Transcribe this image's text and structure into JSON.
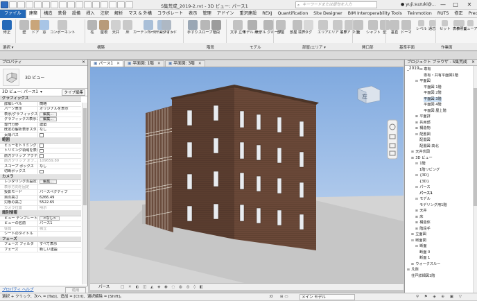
{
  "app": {
    "doc_title": "S集荒成_2019-2.rvt - 3D ビュー: パース1",
    "search_placeholder": "キーワードまたは語句を入力",
    "user": "yuji.suzuki@...",
    "win": {
      "min": "—",
      "max": "□",
      "close": "✕"
    }
  },
  "ribbon_tabs": [
    "ファイル",
    "建築",
    "構造",
    "鉄骨",
    "設備",
    "挿入",
    "注釈",
    "解析",
    "マス & 外構",
    "コラボレート",
    "表示",
    "管理",
    "アドイン",
    "重沢建設",
    "REXJ",
    "Quantification",
    "Site Designer",
    "BIM Interoperability Tools",
    "Twinmotion",
    "RUTS",
    "修正",
    "Precast"
  ],
  "ribbon_buttons": [
    "修正",
    "壁",
    "ドア",
    "窓",
    "コンポーネント",
    "柱",
    "屋根",
    "天井",
    "床",
    "カーテン システム",
    "カーテン グリッド",
    "マリオン",
    "手すり",
    "スロープ",
    "階段",
    "文字 立体",
    "モデル 線分",
    "モデル グループ",
    "部屋",
    "部屋 境界",
    "タグ",
    "エリア",
    "エリア 境界",
    "エリア タグ",
    "面",
    "シャフト",
    "壁",
    "垂直",
    "ドーマ",
    "レベル",
    "通芯",
    "セット",
    "表示",
    "参照面",
    "ビューア"
  ],
  "ribbon_groups": {
    "select": "選択 ▾",
    "build": "構築",
    "circulation": "階段",
    "model": "モデル",
    "room": "部屋/エリア ▾",
    "opening": "開口部",
    "datum": "基準平面",
    "workplane": "作業面"
  },
  "properties": {
    "title": "プロパティ",
    "type_name": "3D ビュー",
    "instance": "3D ビュー: パース1",
    "edit_type": "タイプ編集",
    "help": "プロパティ ヘルプ",
    "apply": "適用",
    "groups": [
      {
        "name": "グラフィックス",
        "rows": [
          {
            "k": "詳細レベル",
            "v": "簡略"
          },
          {
            "k": "パーツ表示",
            "v": "オリジナルを表示"
          },
          {
            "k": "表示/グラフィックス...",
            "v": "編集...",
            "btn": true
          },
          {
            "k": "グラフィックス表示オ...",
            "v": "編集...",
            "btn": true
          },
          {
            "k": "専門分野",
            "v": "建築"
          },
          {
            "k": "既定の解析表示スタ...",
            "v": "なし"
          },
          {
            "k": "太陽パス",
            "v": "",
            "cb": true
          }
        ]
      },
      {
        "name": "範囲",
        "rows": [
          {
            "k": "ビューをトリミング",
            "v": "",
            "cb": true
          },
          {
            "k": "トリミング領域を表示",
            "v": "",
            "cb": true
          },
          {
            "k": "前方クリップ アクティ...",
            "v": "",
            "cb": true
          },
          {
            "k": "前方クリップ オフ...",
            "v": "109659.89",
            "dim": true
          },
          {
            "k": "スコープ ボックス",
            "v": "なし"
          },
          {
            "k": "切断ボックス",
            "v": "",
            "cb": true
          }
        ]
      },
      {
        "name": "カメラ",
        "rows": [
          {
            "k": "レンダリングの設定",
            "v": "編集...",
            "btn": true
          },
          {
            "k": "表示方向を固定",
            "v": "",
            "dim": true
          },
          {
            "k": "投影モード",
            "v": "パースペクティブ"
          },
          {
            "k": "目の高さ",
            "v": "6266.49"
          },
          {
            "k": "対象の高さ",
            "v": "5522.65"
          },
          {
            "k": "カメラ位置",
            "v": "明示",
            "dim": true
          }
        ]
      },
      {
        "name": "識別情報",
        "rows": [
          {
            "k": "ビュー テンプレート",
            "v": "<なし>",
            "btn": true
          },
          {
            "k": "ビューの名前",
            "v": "パース1"
          },
          {
            "k": "従属",
            "v": "独立",
            "dim": true
          },
          {
            "k": "シートのタイトル",
            "v": ""
          }
        ]
      },
      {
        "name": "フェーズ",
        "rows": [
          {
            "k": "フェーズ フィルタ",
            "v": "すべて表示"
          },
          {
            "k": "フェーズ",
            "v": "新しい建設"
          }
        ]
      }
    ]
  },
  "view_tabs": [
    {
      "label": "パース1",
      "active": true
    },
    {
      "label": "平面図: 1階",
      "active": false
    },
    {
      "label": "平面図: 3階",
      "active": false
    }
  ],
  "viewcube_label": "左",
  "view_ctrl": {
    "name": "パース",
    "model": "メイン モデル"
  },
  "status": {
    "hint": "選択 + クリック、次へ = [Tab]、追加 = [Ctrl]、選択解除 = [Shift]。",
    "zero": ":0"
  },
  "browser": {
    "title": "プロジェクト ブラウザ - S集荒成_2019...",
    "items": [
      {
        "t": "▪",
        "label": "専有",
        "d": 3
      },
      {
        "t": "",
        "label": "専有・共有平面図1階",
        "d": 4
      },
      {
        "t": "▪",
        "label": "平面図",
        "d": 2
      },
      {
        "t": "",
        "label": "平面図 1階",
        "d": 4
      },
      {
        "t": "",
        "label": "平面図 2階",
        "d": 4
      },
      {
        "t": "",
        "label": "平面図 3階",
        "d": 4,
        "sel": true
      },
      {
        "t": "",
        "label": "平面図 4階",
        "d": 4
      },
      {
        "t": "",
        "label": "平面図 屋上階",
        "d": 4
      },
      {
        "t": "▸",
        "label": "平面詳",
        "d": 2
      },
      {
        "t": "▸",
        "label": "共用部",
        "d": 2
      },
      {
        "t": "▸",
        "label": "構造物",
        "d": 2
      },
      {
        "t": "▪",
        "label": "配置図",
        "d": 2
      },
      {
        "t": "",
        "label": "配置図",
        "d": 3
      },
      {
        "t": "",
        "label": "配置図-高北",
        "d": 3
      },
      {
        "t": "▸",
        "label": "天井伏図",
        "d": 1
      },
      {
        "t": "▸",
        "label": "3D ビュー",
        "d": 1
      },
      {
        "t": "▪",
        "label": "1階",
        "d": 2
      },
      {
        "t": "",
        "label": "1階リビング",
        "d": 3
      },
      {
        "t": "▪",
        "label": "{3D}",
        "d": 2
      },
      {
        "t": "",
        "label": "{3D}",
        "d": 3
      },
      {
        "t": "▪",
        "label": "パース",
        "d": 2
      },
      {
        "t": "",
        "label": "パース1",
        "d": 3,
        "bold": true
      },
      {
        "t": "▪",
        "label": "モデル",
        "d": 2
      },
      {
        "t": "",
        "label": "モデリング用1階",
        "d": 3
      },
      {
        "t": "▸",
        "label": "天井",
        "d": 2
      },
      {
        "t": "▸",
        "label": "床",
        "d": 2
      },
      {
        "t": "▸",
        "label": "構造体",
        "d": 2
      },
      {
        "t": "▸",
        "label": "階段手",
        "d": 2
      },
      {
        "t": "▸",
        "label": "立面図",
        "d": 1
      },
      {
        "t": "▪",
        "label": "断面図",
        "d": 1
      },
      {
        "t": "▪",
        "label": "断面",
        "d": 2
      },
      {
        "t": "",
        "label": "断面 0",
        "d": 3
      },
      {
        "t": "",
        "label": "断面 1",
        "d": 3
      },
      {
        "t": "▸",
        "label": "ウォークスルー",
        "d": 1
      },
      {
        "t": "▸",
        "label": "凡例",
        "d": 0
      },
      {
        "t": "",
        "label": "住戸詳細図1階",
        "d": 1
      }
    ]
  },
  "colors": {
    "sky": "#8fb6e5",
    "brick": "#5c3f30",
    "accent": "#2469b8"
  }
}
